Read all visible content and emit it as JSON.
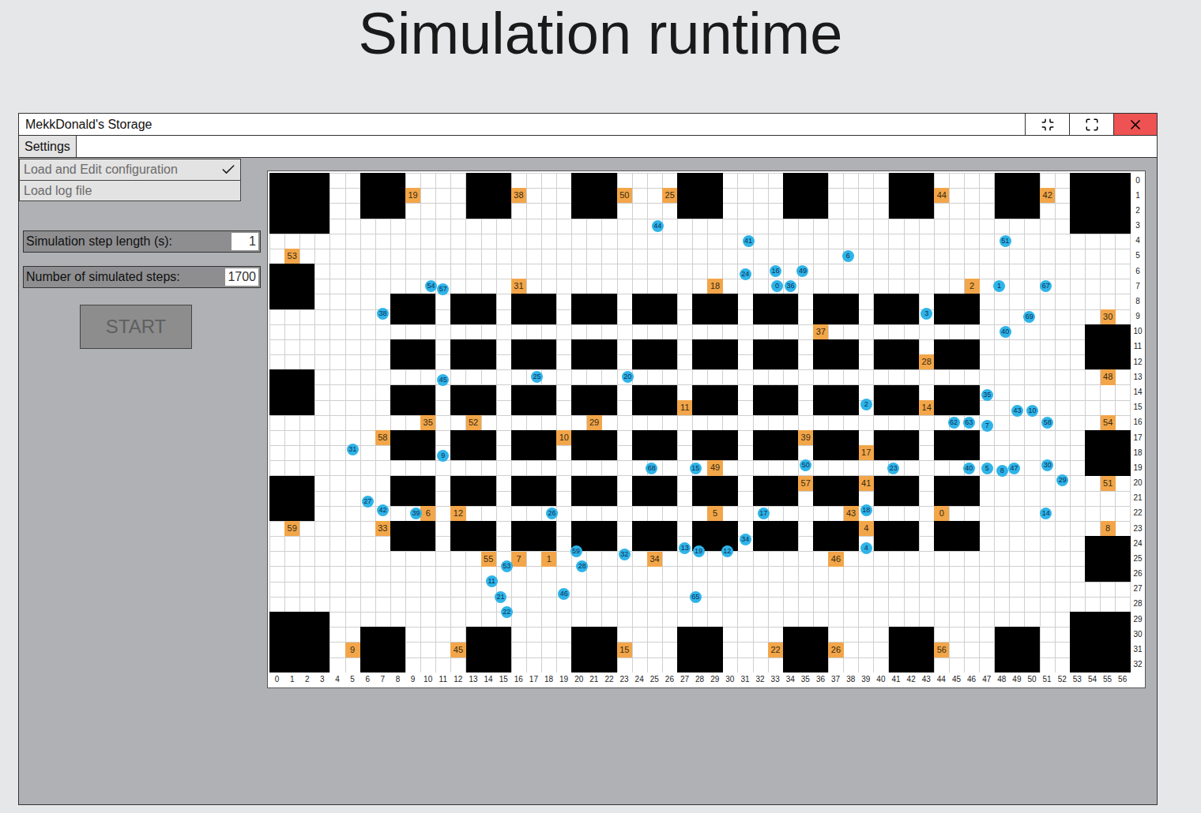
{
  "page_title": "Simulation runtime",
  "window": {
    "title": "MekkDonald's Storage"
  },
  "menu": {
    "label": "Settings",
    "open": true,
    "items": [
      {
        "label": "Load and Edit configuration",
        "checked": true
      },
      {
        "label": "Load log file",
        "checked": false
      }
    ]
  },
  "fields": [
    {
      "label": "Simulation step length (s):",
      "value": "1"
    },
    {
      "label": "Number of simulated steps:",
      "value": "1700"
    }
  ],
  "start_button": {
    "label": "START",
    "disabled": true
  },
  "map": {
    "col_labels": [
      "0",
      "1",
      "2",
      "3",
      "4",
      "5",
      "6",
      "7",
      "8",
      "9",
      "10",
      "11",
      "12",
      "13",
      "14",
      "15",
      "16",
      "17",
      "18",
      "19",
      "20",
      "21",
      "22",
      "23",
      "24",
      "25",
      "26",
      "27",
      "28",
      "29",
      "30",
      "31",
      "32",
      "33",
      "34",
      "35",
      "36",
      "37",
      "38",
      "39",
      "40",
      "41",
      "42",
      "43",
      "44",
      "45",
      "46",
      "47",
      "48",
      "49",
      "50",
      "51",
      "52",
      "53",
      "54",
      "55",
      "56"
    ],
    "row_labels": [
      "0",
      "1",
      "2",
      "3",
      "4",
      "5",
      "6",
      "7",
      "8",
      "9",
      "10",
      "11",
      "12",
      "13",
      "14",
      "15",
      "16",
      "17",
      "18",
      "19",
      "20",
      "21",
      "22",
      "23",
      "24",
      "25",
      "26",
      "27",
      "28",
      "29",
      "30",
      "31",
      "32"
    ],
    "walls": [
      [
        0,
        0,
        4,
        4
      ],
      [
        6,
        0,
        3,
        3
      ],
      [
        13,
        0,
        3,
        3
      ],
      [
        20,
        0,
        3,
        3
      ],
      [
        27,
        0,
        3,
        3
      ],
      [
        34,
        0,
        3,
        3
      ],
      [
        41,
        0,
        3,
        3
      ],
      [
        48,
        0,
        3,
        3
      ],
      [
        53,
        0,
        4,
        4
      ],
      [
        0,
        6,
        3,
        3
      ],
      [
        0,
        13,
        3,
        3
      ],
      [
        0,
        20,
        3,
        3
      ],
      [
        54,
        10,
        3,
        3
      ],
      [
        54,
        17,
        3,
        3
      ],
      [
        54,
        24,
        3,
        3
      ],
      [
        0,
        29,
        4,
        4
      ],
      [
        6,
        30,
        3,
        3
      ],
      [
        13,
        30,
        3,
        3
      ],
      [
        20,
        30,
        3,
        3
      ],
      [
        27,
        30,
        3,
        3
      ],
      [
        34,
        30,
        3,
        3
      ],
      [
        41,
        30,
        3,
        3
      ],
      [
        48,
        30,
        3,
        3
      ],
      [
        53,
        29,
        4,
        4
      ]
    ],
    "shelves": {
      "cols": [
        8,
        12,
        16,
        20,
        24,
        28,
        32,
        36,
        40,
        44
      ],
      "rows": [
        8,
        11,
        14,
        17,
        20,
        23
      ],
      "width": 3,
      "height": 2
    },
    "targets": [
      {
        "label": "19",
        "col": 9,
        "row": 1
      },
      {
        "label": "38",
        "col": 16,
        "row": 1
      },
      {
        "label": "50",
        "col": 23,
        "row": 1
      },
      {
        "label": "25",
        "col": 26,
        "row": 1
      },
      {
        "label": "44",
        "col": 44,
        "row": 1
      },
      {
        "label": "42",
        "col": 51,
        "row": 1
      },
      {
        "label": "53",
        "col": 1,
        "row": 5
      },
      {
        "label": "31",
        "col": 16,
        "row": 7
      },
      {
        "label": "18",
        "col": 29,
        "row": 7
      },
      {
        "label": "2",
        "col": 46,
        "row": 7
      },
      {
        "label": "30",
        "col": 55,
        "row": 9
      },
      {
        "label": "37",
        "col": 36,
        "row": 10
      },
      {
        "label": "28",
        "col": 43,
        "row": 12
      },
      {
        "label": "48",
        "col": 55,
        "row": 13
      },
      {
        "label": "11",
        "col": 27,
        "row": 15
      },
      {
        "label": "14",
        "col": 43,
        "row": 15
      },
      {
        "label": "35",
        "col": 10,
        "row": 16
      },
      {
        "label": "52",
        "col": 13,
        "row": 16
      },
      {
        "label": "29",
        "col": 21,
        "row": 16
      },
      {
        "label": "54",
        "col": 55,
        "row": 16
      },
      {
        "label": "58",
        "col": 7,
        "row": 17
      },
      {
        "label": "10",
        "col": 19,
        "row": 17
      },
      {
        "label": "39",
        "col": 35,
        "row": 17
      },
      {
        "label": "17",
        "col": 39,
        "row": 18
      },
      {
        "label": "49",
        "col": 29,
        "row": 19
      },
      {
        "label": "57",
        "col": 35,
        "row": 20
      },
      {
        "label": "41",
        "col": 39,
        "row": 20
      },
      {
        "label": "51",
        "col": 55,
        "row": 20
      },
      {
        "label": "6",
        "col": 10,
        "row": 22
      },
      {
        "label": "12",
        "col": 12,
        "row": 22
      },
      {
        "label": "5",
        "col": 29,
        "row": 22
      },
      {
        "label": "43",
        "col": 38,
        "row": 22
      },
      {
        "label": "0",
        "col": 44,
        "row": 22
      },
      {
        "label": "59",
        "col": 1,
        "row": 23
      },
      {
        "label": "33",
        "col": 7,
        "row": 23
      },
      {
        "label": "4",
        "col": 39,
        "row": 23
      },
      {
        "label": "8",
        "col": 55,
        "row": 23
      },
      {
        "label": "55",
        "col": 14,
        "row": 25
      },
      {
        "label": "7",
        "col": 16,
        "row": 25
      },
      {
        "label": "1",
        "col": 18,
        "row": 25
      },
      {
        "label": "34",
        "col": 25,
        "row": 25
      },
      {
        "label": "46",
        "col": 37,
        "row": 25
      },
      {
        "label": "9",
        "col": 5,
        "row": 31
      },
      {
        "label": "45",
        "col": 12,
        "row": 31
      },
      {
        "label": "15",
        "col": 23,
        "row": 31
      },
      {
        "label": "22",
        "col": 33,
        "row": 31
      },
      {
        "label": "26",
        "col": 37,
        "row": 31
      },
      {
        "label": "56",
        "col": 44,
        "row": 31
      }
    ],
    "robots": [
      {
        "label": "44",
        "col": 25.7,
        "row": 3.5
      },
      {
        "label": "41",
        "col": 31.7,
        "row": 4.5
      },
      {
        "label": "51",
        "col": 48.7,
        "row": 4.5
      },
      {
        "label": "6",
        "col": 38.3,
        "row": 5.5
      },
      {
        "label": "16",
        "col": 33.5,
        "row": 6.5
      },
      {
        "label": "49",
        "col": 35.3,
        "row": 6.5
      },
      {
        "label": "24",
        "col": 31.5,
        "row": 6.7
      },
      {
        "label": "0",
        "col": 33.6,
        "row": 7.5
      },
      {
        "label": "36",
        "col": 34.5,
        "row": 7.5
      },
      {
        "label": "54",
        "col": 10.7,
        "row": 7.5
      },
      {
        "label": "57",
        "col": 11.5,
        "row": 7.7
      },
      {
        "label": "1",
        "col": 48.3,
        "row": 7.5
      },
      {
        "label": "67",
        "col": 51.4,
        "row": 7.5
      },
      {
        "label": "38",
        "col": 7.5,
        "row": 9.3
      },
      {
        "label": "3",
        "col": 43.5,
        "row": 9.3
      },
      {
        "label": "69",
        "col": 50.3,
        "row": 9.5
      },
      {
        "label": "40",
        "col": 48.7,
        "row": 10.5
      },
      {
        "label": "45",
        "col": 11.5,
        "row": 13.7
      },
      {
        "label": "25",
        "col": 17.7,
        "row": 13.5
      },
      {
        "label": "20",
        "col": 23.7,
        "row": 13.5
      },
      {
        "label": "35",
        "col": 47.5,
        "row": 14.7
      },
      {
        "label": "2",
        "col": 39.5,
        "row": 15.3
      },
      {
        "label": "43",
        "col": 49.5,
        "row": 15.7
      },
      {
        "label": "10",
        "col": 50.5,
        "row": 15.7
      },
      {
        "label": "62",
        "col": 45.3,
        "row": 16.5
      },
      {
        "label": "63",
        "col": 46.3,
        "row": 16.5
      },
      {
        "label": "7",
        "col": 47.5,
        "row": 16.7
      },
      {
        "label": "58",
        "col": 51.5,
        "row": 16.5
      },
      {
        "label": "31",
        "col": 5.5,
        "row": 18.3
      },
      {
        "label": "9",
        "col": 11.5,
        "row": 18.7
      },
      {
        "label": "68",
        "col": 25.3,
        "row": 19.5
      },
      {
        "label": "15",
        "col": 28.2,
        "row": 19.5
      },
      {
        "label": "50",
        "col": 35.5,
        "row": 19.3
      },
      {
        "label": "23",
        "col": 41.3,
        "row": 19.5
      },
      {
        "label": "40",
        "col": 46.3,
        "row": 19.5
      },
      {
        "label": "5",
        "col": 47.5,
        "row": 19.5
      },
      {
        "label": "8",
        "col": 48.5,
        "row": 19.7
      },
      {
        "label": "47",
        "col": 49.3,
        "row": 19.5
      },
      {
        "label": "30",
        "col": 51.5,
        "row": 19.3
      },
      {
        "label": "29",
        "col": 52.5,
        "row": 20.3
      },
      {
        "label": "27",
        "col": 6.5,
        "row": 21.7
      },
      {
        "label": "42",
        "col": 7.5,
        "row": 22.3
      },
      {
        "label": "39",
        "col": 9.7,
        "row": 22.5
      },
      {
        "label": "26",
        "col": 18.7,
        "row": 22.5
      },
      {
        "label": "17",
        "col": 32.7,
        "row": 22.5
      },
      {
        "label": "18",
        "col": 39.5,
        "row": 22.3
      },
      {
        "label": "14",
        "col": 51.4,
        "row": 22.5
      },
      {
        "label": "34",
        "col": 31.5,
        "row": 24.2
      },
      {
        "label": "13",
        "col": 27.5,
        "row": 24.8
      },
      {
        "label": "19",
        "col": 28.4,
        "row": 25.0
      },
      {
        "label": "12",
        "col": 30.3,
        "row": 25.0
      },
      {
        "label": "4",
        "col": 39.5,
        "row": 24.8
      },
      {
        "label": "59",
        "col": 20.3,
        "row": 25.0
      },
      {
        "label": "32",
        "col": 23.5,
        "row": 25.2
      },
      {
        "label": "53",
        "col": 15.7,
        "row": 26.0
      },
      {
        "label": "28",
        "col": 20.7,
        "row": 26.0
      },
      {
        "label": "11",
        "col": 14.7,
        "row": 27.0
      },
      {
        "label": "46",
        "col": 19.5,
        "row": 27.8
      },
      {
        "label": "21",
        "col": 15.3,
        "row": 28.0
      },
      {
        "label": "65",
        "col": 28.2,
        "row": 28.0
      },
      {
        "label": "22",
        "col": 15.7,
        "row": 29.0
      }
    ]
  }
}
